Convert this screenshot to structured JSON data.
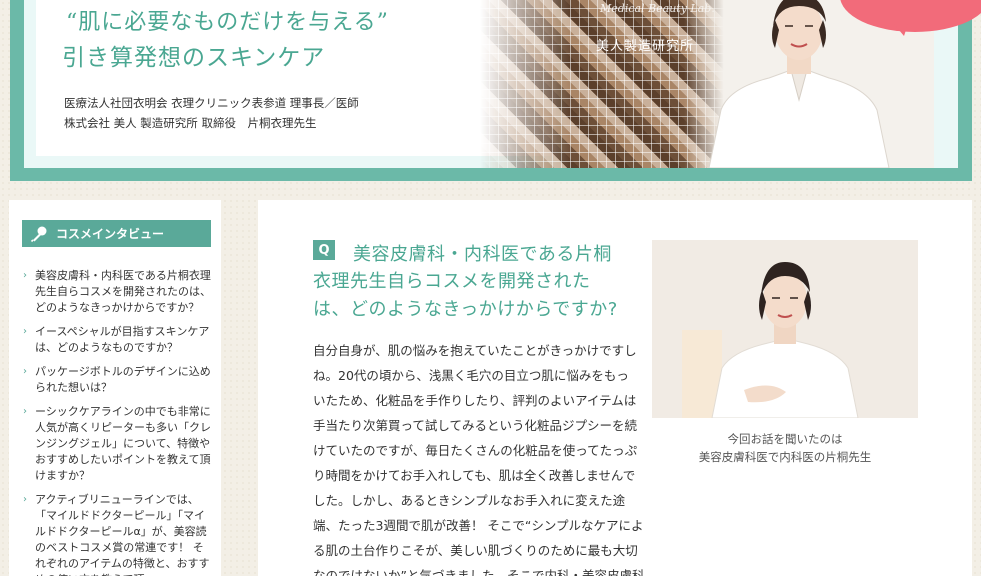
{
  "hero": {
    "quote": "“肌に必要なものだけを与える”",
    "subtitle": "引き算発想のスキンケア",
    "credit_line1": "医療法人社団衣明会 衣理クリニック表参道 理事長／医師",
    "credit_line2": "株式会社 美人 製造研究所 取締役　片桐衣理先生",
    "lab_script": "Medical Beauty Lab.",
    "lab_name": "美人製造研究所"
  },
  "sidebar": {
    "title": "コスメインタビュー",
    "items": [
      {
        "label": "美容皮膚科・内科医である片桐衣理先生自らコスメを開発されたのは、どのようなきっかけからですか？"
      },
      {
        "label": "イースペシャルが目指すスキンケアは、どのようなものですか？"
      },
      {
        "label": "パッケージボトルのデザインに込められた想いは？"
      },
      {
        "label": "ーシックケアラインの中でも非常に人気が高くリピーターも多い「クレンジングジェル」について、特徴やおすすめしたいポイントを教えて頂けますか？"
      },
      {
        "label": "アクティブリニューラインでは、「マイルドドクターピール」「マイルドドクターピールα」が、美容読のベストコスメ賞の常連です！ それぞれのアイテムの特徴と、おすすめの使い方を教えて頂"
      }
    ]
  },
  "main": {
    "q_badge": "Q",
    "question_lines": [
      "美容皮膚科・内科医である片桐",
      "衣理先生自らコスメを開発された",
      "は、どのようなきっかけからですか?"
    ],
    "answer_lines": [
      "自分自身が、肌の悩みを抱えていたことがきっかけですし",
      "ね。20代の頃から、浅黒く毛穴の目立つ肌に悩みをもっ",
      "いたため、化粧品を手作りしたり、評判のよいアイテムは",
      "手当たり次第買って試してみるという化粧品ジプシーを続",
      "けていたのですが、毎日たくさんの化粧品を使ってたっぷ",
      "り時間をかけてお手入れしても、肌は全く改善しませんで",
      "した。しかし、あるときシンプルなお手入れに変えた途",
      "端、たった3週間で肌が改善！ そこで“シンプルなケアによ",
      "る肌の土台作りこそが、美しい肌づくりのために最も大切",
      "なのではないか”と気づきました。そこで内科・美容皮膚科"
    ],
    "caption_line1": "今回お話を聞いたのは",
    "caption_line2": "美容皮膚科医で内科医の片桐先生"
  },
  "colors": {
    "accent": "#5aa999",
    "hero_border": "#6bb9a8",
    "text_teal": "#4aa792",
    "badge_pink": "#f26b7a"
  },
  "icons": {
    "sidebar_header": "microphone-icon",
    "list_bullet": "chevron-right-icon"
  }
}
